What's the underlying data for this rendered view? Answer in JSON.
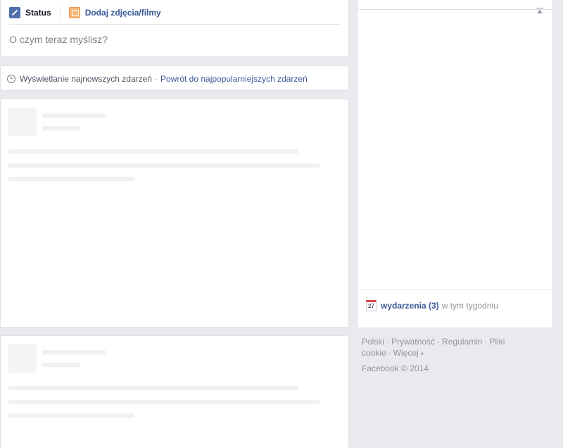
{
  "composer": {
    "tabs": [
      {
        "label": "Status"
      },
      {
        "label": "Dodaj zdjęcia/filmy"
      }
    ],
    "placeholder": "O czym teraz myślisz?"
  },
  "sort": {
    "current": "Wyświetlanie najnowszych zdarzeń",
    "separator": "·",
    "switch_link": "Powrót do najpopularniejszych zdarzeń",
    "icon": "clock-icon"
  },
  "sidebar": {
    "events": {
      "calendar_day": "27",
      "link": "wydarzenia (3)",
      "rest": "w tym tygodniu"
    }
  },
  "footer": {
    "links": [
      "Polski",
      "Prywatność",
      "Regulamin",
      "Pliki cookie",
      "Więcej"
    ],
    "separator": "·",
    "copyright": "Facebook © 2014"
  },
  "colors": {
    "link": "#3b5998",
    "background": "#e9eaed",
    "placeholder": "#f0f1f3"
  }
}
